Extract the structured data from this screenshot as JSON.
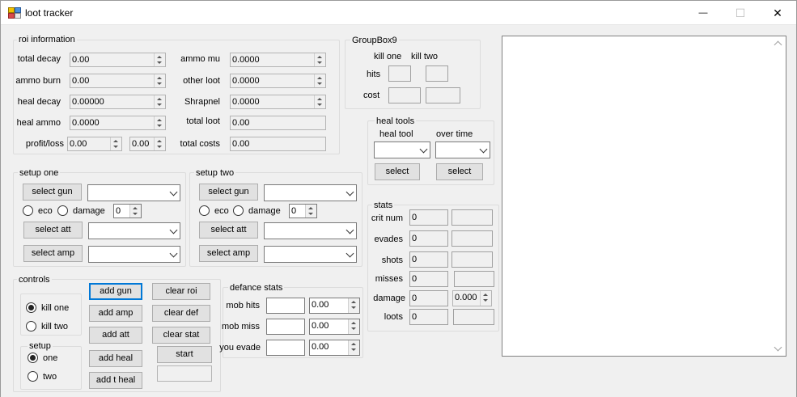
{
  "window": {
    "title": "loot tracker",
    "minimize": "—",
    "maximize": "☐",
    "close": "✕"
  },
  "roi": {
    "title": "roi information",
    "total_decay": {
      "label": "total decay",
      "value": "0.00"
    },
    "ammo_burn": {
      "label": "ammo burn",
      "value": "0.00"
    },
    "heal_decay": {
      "label": "heal decay",
      "value": "0.00000"
    },
    "heal_ammo": {
      "label": "heal ammo",
      "value": "0.0000"
    },
    "profit_loss": {
      "label": "profit/loss",
      "value": "0.00",
      "value2": "0.00"
    },
    "ammo_mu": {
      "label": "ammo mu",
      "value": "0.0000"
    },
    "other_loot": {
      "label": "other loot",
      "value": "0.0000"
    },
    "shrapnel": {
      "label": "Shrapnel",
      "value": "0.0000"
    },
    "total_loot": {
      "label": "total loot",
      "value": "0.00"
    },
    "total_costs": {
      "label": "total costs",
      "value": "0.00"
    }
  },
  "groupbox9": {
    "title": "GroupBox9",
    "kill_one": "kill one",
    "kill_two": "kill two",
    "hits": "hits",
    "cost": "cost"
  },
  "heal_tools": {
    "title": "heal tools",
    "heal_tool": "heal tool",
    "over_time": "over time",
    "select": "select"
  },
  "setup_one": {
    "title": "setup one",
    "select_gun": "select gun",
    "eco": "eco",
    "damage": "damage",
    "count": "0",
    "select_att": "select att",
    "select_amp": "select amp"
  },
  "setup_two": {
    "title": "setup two",
    "select_gun": "select gun",
    "eco": "eco",
    "damage": "damage",
    "count": "0",
    "select_att": "select att",
    "select_amp": "select amp"
  },
  "stats": {
    "title": "stats",
    "rows": [
      {
        "label": "crit num",
        "v1": "0",
        "v2": ""
      },
      {
        "label": "evades",
        "v1": "0",
        "v2": ""
      },
      {
        "label": "shots",
        "v1": "0",
        "v2": ""
      },
      {
        "label": "misses",
        "v1": "0",
        "v2": ""
      },
      {
        "label": "damage",
        "v1": "0",
        "v2": "0.000"
      },
      {
        "label": "loots",
        "v1": "0",
        "v2": ""
      }
    ]
  },
  "controls": {
    "title": "controls",
    "kill_one": "kill one",
    "kill_two": "kill two",
    "setup_title": "setup",
    "one": "one",
    "two": "two",
    "add_gun": "add gun",
    "add_amp": "add amp",
    "add_att": "add att",
    "add_heal": "add heal",
    "add_t_heal": "add t heal",
    "clear_roi": "clear roi",
    "clear_def": "clear def",
    "clear_stat": "clear stat",
    "start": "start"
  },
  "defence": {
    "title": "defance stats",
    "mob_hits": {
      "label": "mob hits",
      "value": "0.00"
    },
    "mob_miss": {
      "label": "mob miss",
      "value": "0.00"
    },
    "you_evade": {
      "label": "you evade",
      "value": "0.00"
    }
  }
}
